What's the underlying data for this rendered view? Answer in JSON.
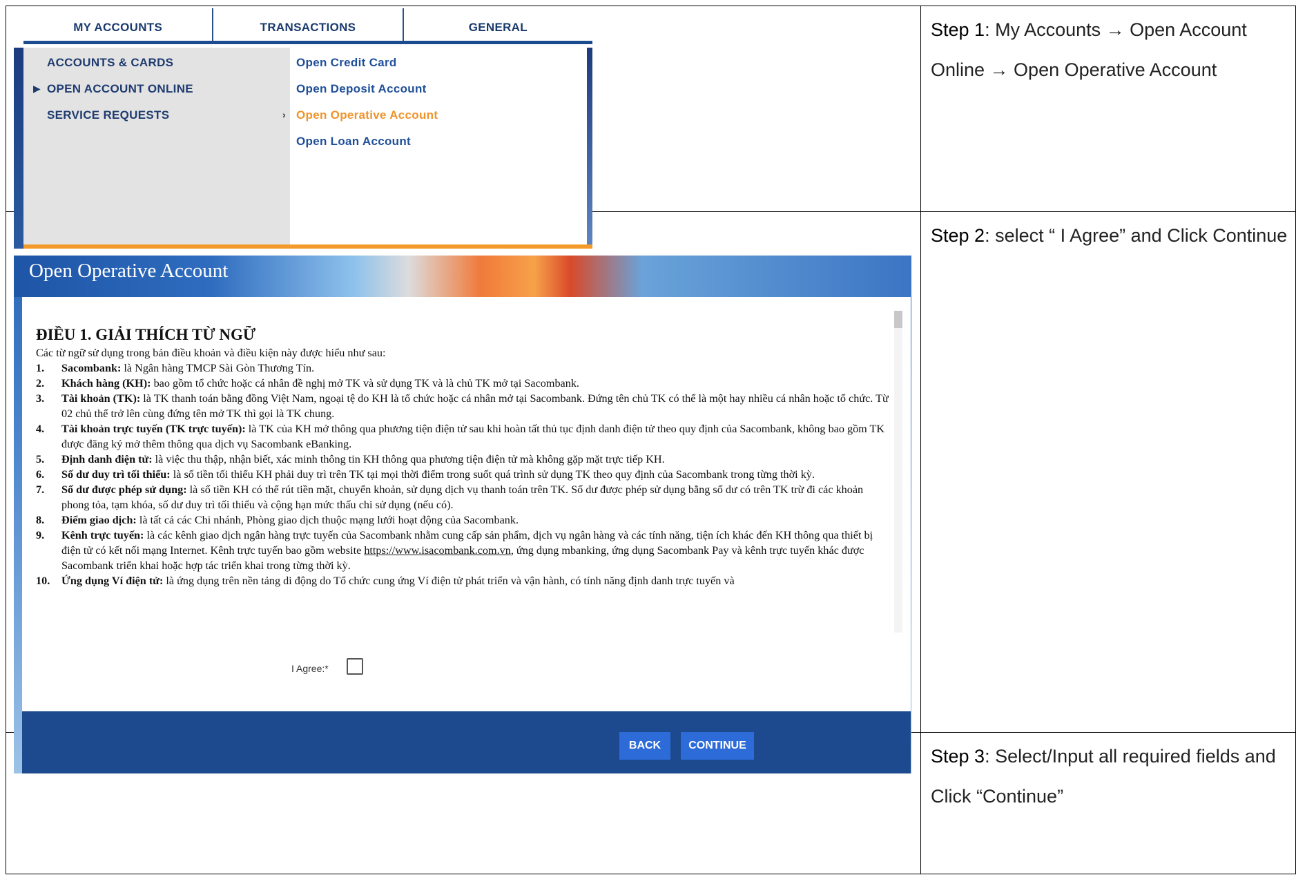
{
  "steps": [
    {
      "label": "Step 1",
      "text": ": My Accounts → Open Account Online → Open Operative Account"
    },
    {
      "label": "Step 2",
      "text": ": select “ I Agree” and Click Continue"
    },
    {
      "label": "Step 3",
      "text": ": Select/Input all required fields and Click “Continue”"
    }
  ],
  "menu": {
    "tabs": [
      "MY ACCOUNTS",
      "TRANSACTIONS",
      "GENERAL"
    ],
    "left_items": [
      "ACCOUNTS & CARDS",
      "OPEN ACCOUNT ONLINE",
      "SERVICE REQUESTS"
    ],
    "right_items": [
      "Open Credit Card",
      "Open Deposit Account",
      "Open Operative Account",
      "Open Loan Account"
    ]
  },
  "terms": {
    "title": "Open Operative Account",
    "heading": "ĐIỀU 1.    GIẢI THÍCH TỪ NGỮ",
    "intro": "Các từ ngữ sử dụng trong bản điều khoản và điều kiện này được hiểu như sau:",
    "items": [
      {
        "n": "1.",
        "term": "Sacombank:",
        "text": " là Ngân hàng TMCP Sài Gòn Thương Tín."
      },
      {
        "n": "2.",
        "term": "Khách hàng (KH):",
        "text": " bao gồm tổ chức hoặc cá nhân đề nghị mở TK và sử dụng TK và là chủ TK mở tại Sacombank."
      },
      {
        "n": "3.",
        "term": "Tài khoản (TK):",
        "text": " là TK thanh toán bằng đồng Việt Nam, ngoại tệ do KH là tổ chức hoặc cá nhân mở tại Sacombank. Đứng tên chủ TK có thể là một hay nhiều cá nhân hoặc tổ chức. Từ 02 chủ thể trở lên cùng đứng tên mở TK thì gọi là TK chung."
      },
      {
        "n": "4.",
        "term": "Tài khoản trực tuyến (TK trực tuyến):",
        "text": " là TK của KH mở thông qua phương tiện điện tử sau khi hoàn tất thủ tục định danh điện tử theo quy định của Sacombank, không bao gồm TK được đăng ký mở thêm thông qua dịch vụ Sacombank eBanking."
      },
      {
        "n": "5.",
        "term": "Định danh điện tử:",
        "text": " là việc thu thập, nhận biết, xác minh thông tin KH thông qua phương tiện điện tử mà không gặp mặt trực tiếp KH."
      },
      {
        "n": "6.",
        "term": "Số dư duy trì tối thiểu:",
        "text": " là số tiền tối thiểu KH phải duy trì trên TK tại mọi thời điểm trong suốt quá trình sử dụng TK theo quy định của Sacombank trong từng thời kỳ."
      },
      {
        "n": "7.",
        "term": "Số dư được phép sử dụng:",
        "text": " là số tiền KH có thể rút tiền mặt, chuyển khoản, sử dụng dịch vụ thanh toán trên TK. Số dư được phép sử dụng bằng số dư có trên TK trừ đi các khoản phong tỏa, tạm khóa, số dư duy trì tối thiểu và cộng hạn mức thấu chi sử dụng (nếu có)."
      },
      {
        "n": "8.",
        "term": "Điểm giao dịch:",
        "text": " là tất cả các Chi nhánh, Phòng giao dịch thuộc mạng lưới hoạt động của Sacombank."
      },
      {
        "n": "9.",
        "term": "Kênh trực tuyến:",
        "text": " là các kênh giao dịch ngân hàng trực tuyến của Sacombank nhằm cung cấp sản phẩm, dịch vụ ngân hàng và các tính năng, tiện ích khác đến KH thông qua thiết bị điện tử có kết nối mạng Internet. Kênh trực tuyến bao gồm website ",
        "link": "https://www.isacombank.com.vn",
        "text2": ", ứng dụng mbanking, ứng dụng Sacombank Pay và kênh trực tuyến khác được Sacombank triển khai hoặc hợp tác triển khai trong từng thời kỳ."
      },
      {
        "n": "10.",
        "term": "Ứng dụng Ví điện tử:",
        "text": " là ứng dụng trên nền tảng di động do Tổ chức cung ứng Ví điện tử phát triển và vận hành, có tính năng định danh trực tuyến và"
      }
    ],
    "agree_label": "I Agree:*",
    "back_label": "BACK",
    "continue_label": "CONTINUE"
  }
}
